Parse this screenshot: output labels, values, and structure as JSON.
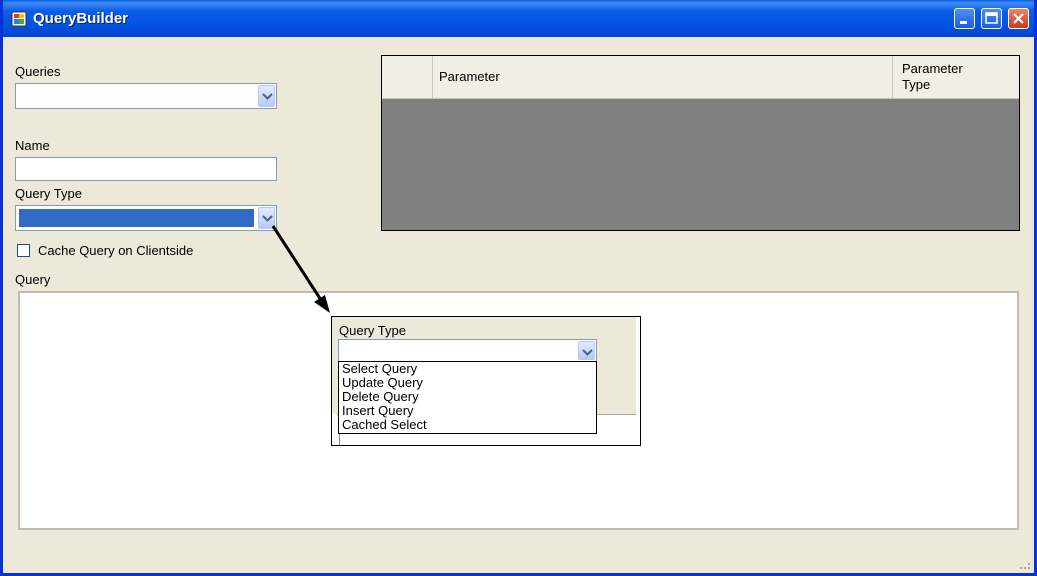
{
  "window": {
    "title": "QueryBuilder",
    "controls": {
      "minimize": "minimize-icon",
      "maximize": "maximize-icon",
      "close": "close-icon"
    }
  },
  "form": {
    "queries_label": "Queries",
    "queries_value": "",
    "name_label": "Name",
    "name_value": "",
    "query_type_label": "Query Type",
    "query_type_value": "",
    "cache_checkbox_label": "Cache Query on Clientside",
    "cache_checked": false,
    "query_label": "Query",
    "query_value": ""
  },
  "parameters_grid": {
    "columns": [
      "Parameter",
      "Parameter Type"
    ],
    "rows": []
  },
  "inset": {
    "label": "Query Type",
    "options": [
      "Select Query",
      "Update Query",
      "Delete Query",
      "Insert Query",
      "Cached Select"
    ]
  },
  "colors": {
    "selected_highlight": "#316ac5",
    "grid_background": "#808080",
    "window_background": "#ece9d8",
    "titlebar": "#0353e3"
  }
}
